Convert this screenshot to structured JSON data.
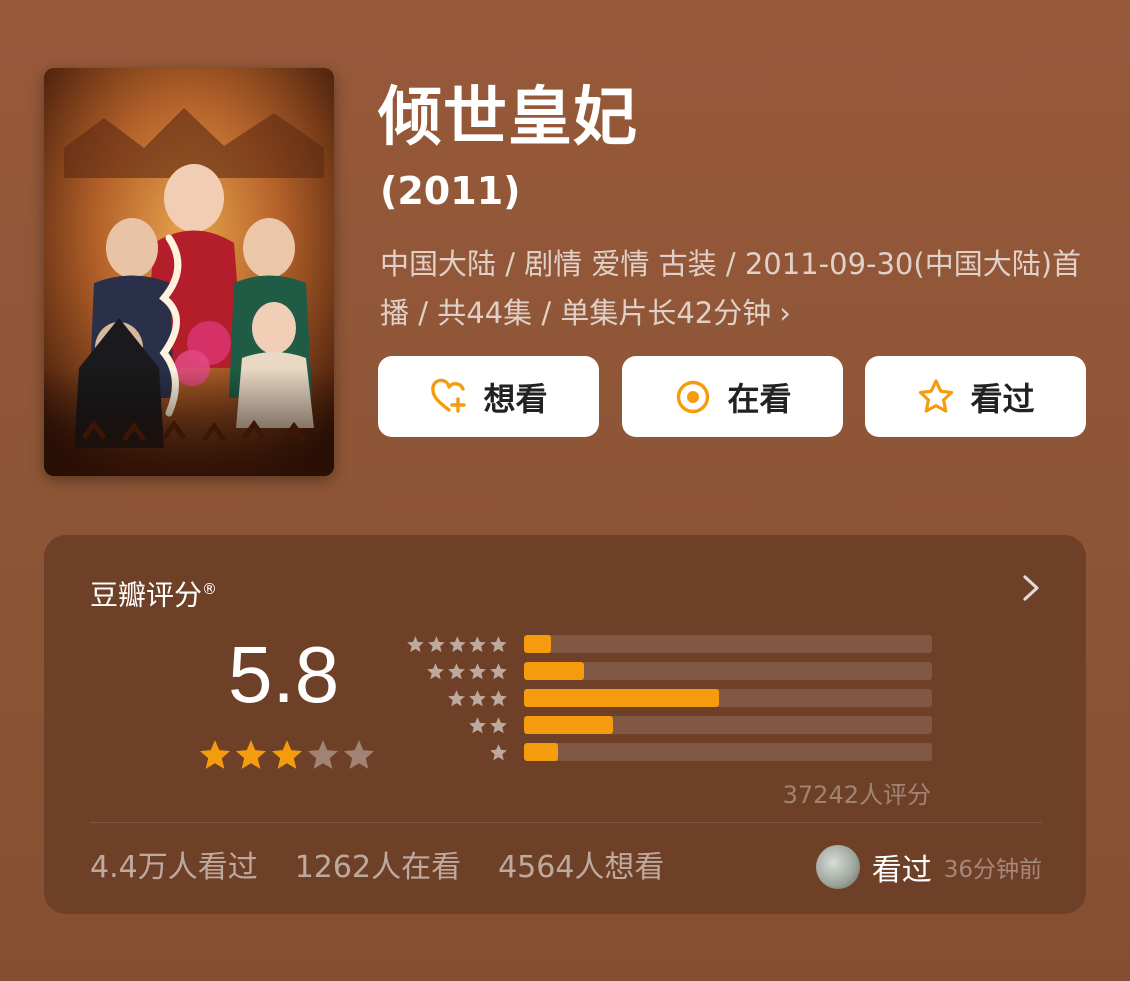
{
  "title": "倾世皇妃",
  "year": "(2011)",
  "meta": "中国大陆 / 剧情 爱情 古装 / 2011-09-30(中国大陆)首播 / 共44集 / 单集片长42分钟",
  "meta_chevron": "›",
  "actions": {
    "want": "想看",
    "watching": "在看",
    "watched": "看过"
  },
  "colors": {
    "accent": "#f59c0e",
    "background": "#8f5636",
    "card": "#6f4028"
  },
  "rating": {
    "label": "豆瓣评分",
    "registered": "®",
    "score": "5.8",
    "stars": 3,
    "distribution": [
      {
        "stars": 5,
        "fraction": 0.066
      },
      {
        "stars": 4,
        "fraction": 0.147
      },
      {
        "stars": 3,
        "fraction": 0.479
      },
      {
        "stars": 2,
        "fraction": 0.218
      },
      {
        "stars": 1,
        "fraction": 0.084
      }
    ],
    "count": "37242人评分"
  },
  "stats": {
    "watched": "4.4万人看过",
    "watching": "1262人在看",
    "want": "4564人想看"
  },
  "friend": {
    "status": "看过",
    "time": "36分钟前"
  }
}
